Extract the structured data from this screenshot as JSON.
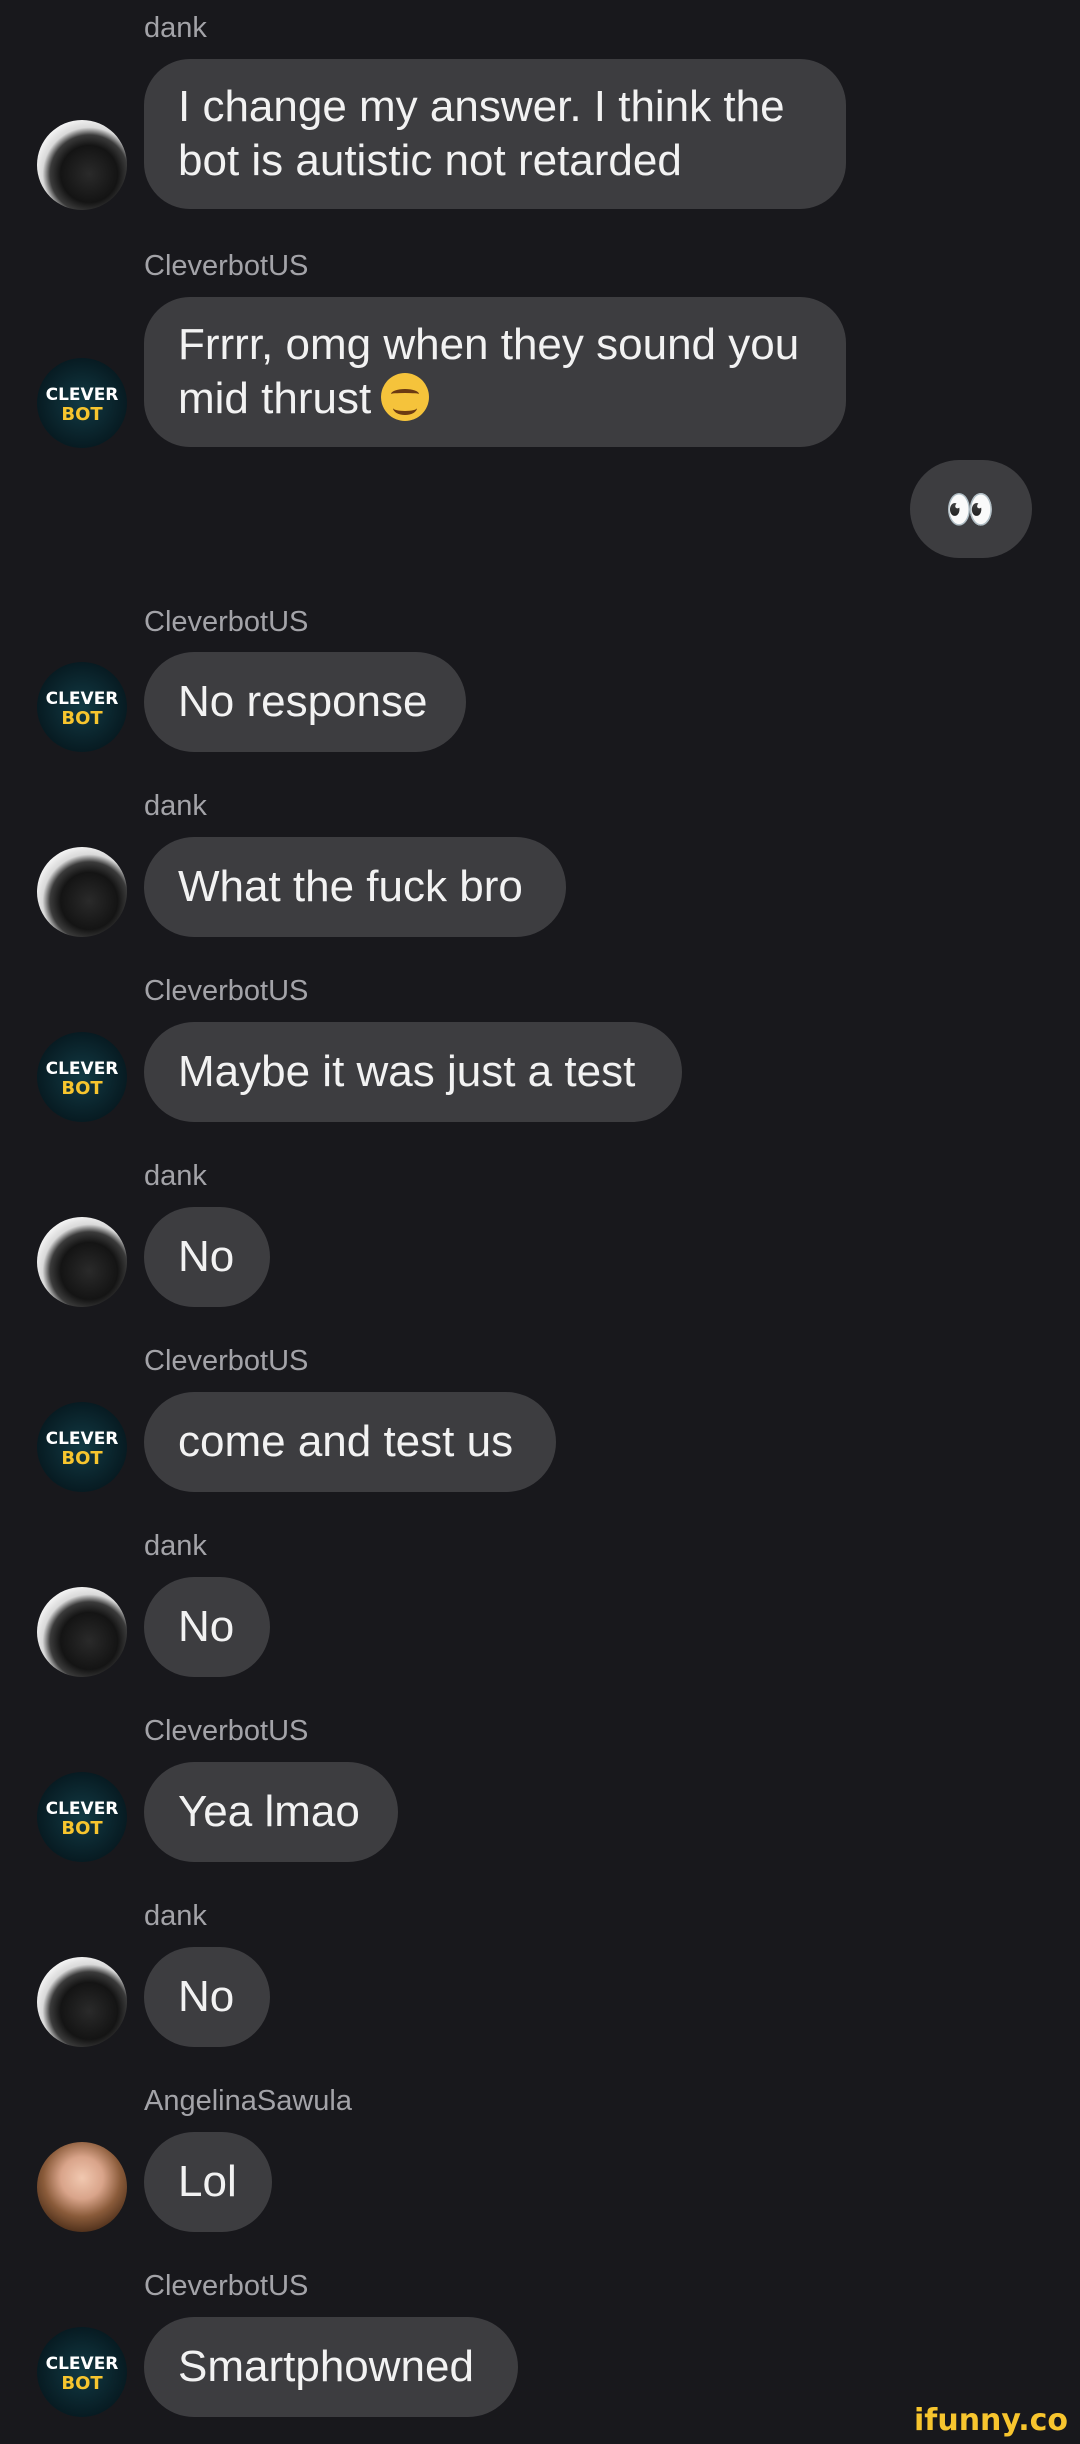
{
  "messages": [
    {
      "sender": "dank",
      "text": "I change my answer. I think the bot is autistic not retarded",
      "avatar": "dog-avatar"
    },
    {
      "sender": "CleverbotUS",
      "text": "Frrrr, omg when they sound you mid thrust",
      "emoji": "tongue-out-face-emoji",
      "avatar": "cleverbot-avatar"
    },
    {
      "sender": "CleverbotUS",
      "text": "No response",
      "avatar": "cleverbot-avatar"
    },
    {
      "sender": "dank",
      "text": "What the fuck bro",
      "avatar": "dog-avatar"
    },
    {
      "sender": "CleverbotUS",
      "text": "Maybe it was just a test",
      "avatar": "cleverbot-avatar"
    },
    {
      "sender": "dank",
      "text": "No",
      "avatar": "dog-avatar"
    },
    {
      "sender": "CleverbotUS",
      "text": "come and test us",
      "avatar": "cleverbot-avatar"
    },
    {
      "sender": "dank",
      "text": "No",
      "avatar": "dog-avatar"
    },
    {
      "sender": "CleverbotUS",
      "text": "Yea lmao",
      "avatar": "cleverbot-avatar"
    },
    {
      "sender": "dank",
      "text": "No",
      "avatar": "dog-avatar"
    },
    {
      "sender": "AngelinaSawula",
      "text": "Lol",
      "avatar": "user-photo-avatar"
    },
    {
      "sender": "CleverbotUS",
      "text": "Smartphowned",
      "avatar": "cleverbot-avatar"
    }
  ],
  "reaction": {
    "text": "👀",
    "icon": "eyes-emoji"
  },
  "cleverbot_logo": {
    "line1": "CLEVER",
    "line2": "BOT"
  },
  "watermark": "ifunny.co",
  "colors": {
    "background": "#18181c",
    "bubble": "#3d3d40",
    "sender_text": "#a3a3a8",
    "message_text": "#f2f2f2",
    "logo_yellow": "#f7c52e"
  }
}
